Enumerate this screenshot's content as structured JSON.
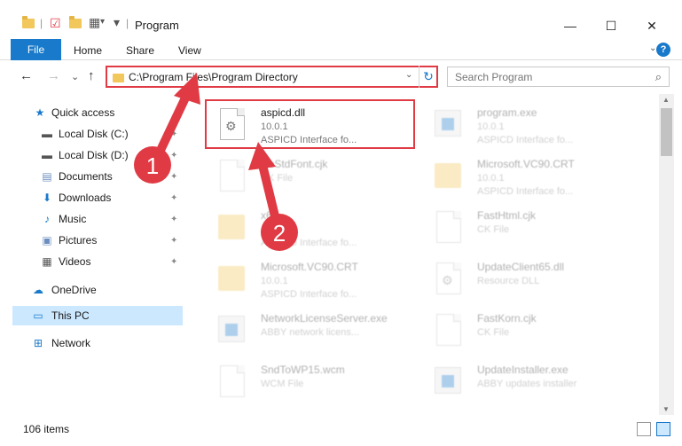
{
  "window": {
    "title": "Program",
    "minimize_glyph": "—",
    "maximize_glyph": "☐",
    "close_glyph": "✕"
  },
  "ribbon": {
    "tabs": [
      "File",
      "Home",
      "Share",
      "View"
    ],
    "help_glyph": "?",
    "expand_glyph": "⌄"
  },
  "nav": {
    "back_glyph": "←",
    "forward_glyph": "→",
    "recent_glyph": "⌄",
    "up_glyph": "↑",
    "address": "C:\\Program Files\\Program Directory",
    "address_dropdown_glyph": "⌄",
    "refresh_glyph": "↻",
    "search_placeholder": "Search Program",
    "search_glyph": "⌕"
  },
  "sidebar": {
    "quick_access": "Quick access",
    "items": [
      {
        "label": "Local Disk (C:)",
        "icon": "drive-icon",
        "pinned": true
      },
      {
        "label": "Local Disk (D:)",
        "icon": "drive-icon",
        "pinned": true
      },
      {
        "label": "Documents",
        "icon": "documents-icon",
        "pinned": true
      },
      {
        "label": "Downloads",
        "icon": "downloads-icon",
        "pinned": true
      },
      {
        "label": "Music",
        "icon": "music-icon",
        "pinned": true
      },
      {
        "label": "Pictures",
        "icon": "pictures-icon",
        "pinned": true
      },
      {
        "label": "Videos",
        "icon": "videos-icon",
        "pinned": true
      }
    ],
    "onedrive": "OneDrive",
    "this_pc": "This PC",
    "network": "Network",
    "pin_glyph": "📌"
  },
  "files": [
    {
      "name": "aspicd.dll",
      "line2": "10.0.1",
      "line3": "ASPICD Interface fo...",
      "icon": "dll-gear-icon",
      "faded": false
    },
    {
      "name": "program.exe",
      "line2": "10.0.1",
      "line3": "ASPICD Interface fo...",
      "icon": "exe-icon",
      "faded": true
    },
    {
      "name": "CoStdFont.cjk",
      "line2": "CK File",
      "line3": "",
      "icon": "file-icon",
      "faded": true
    },
    {
      "name": "Microsoft.VC90.CRT",
      "line2": "10.0.1",
      "line3": "ASPICD Interface fo...",
      "icon": "folder-file-icon",
      "faded": true
    },
    {
      "name": "x64",
      "line2": "10.0.1",
      "line3": "ASPICD Interface fo...",
      "icon": "folder-file-icon",
      "faded": true
    },
    {
      "name": "FastHtml.cjk",
      "line2": "CK File",
      "line3": "",
      "icon": "file-icon",
      "faded": true
    },
    {
      "name": "Microsoft.VC90.CRT",
      "line2": "10.0.1",
      "line3": "ASPICD Interface fo...",
      "icon": "folder-file-icon",
      "faded": true
    },
    {
      "name": "UpdateClient65.dll",
      "line2": "Resource DLL",
      "line3": "",
      "icon": "dll-gear-icon",
      "faded": true
    },
    {
      "name": "NetworkLicenseServer.exe",
      "line2": "ABBY network licens...",
      "line3": "",
      "icon": "exe-icon",
      "faded": true
    },
    {
      "name": "FastKorn.cjk",
      "line2": "CK File",
      "line3": "",
      "icon": "file-icon",
      "faded": true
    },
    {
      "name": "SndToWP15.wcm",
      "line2": "WCM File",
      "line3": "",
      "icon": "file-icon",
      "faded": true
    },
    {
      "name": "UpdateInstaller.exe",
      "line2": "ABBY updates installer",
      "line3": "",
      "icon": "exe-icon",
      "faded": true
    }
  ],
  "status": {
    "item_count": "106 items"
  },
  "annotations": {
    "step1": "1",
    "step2": "2",
    "color": "#e03a44"
  },
  "colors": {
    "accent": "#1979ca",
    "selection": "#cce8ff",
    "highlight": "#e03a44"
  }
}
